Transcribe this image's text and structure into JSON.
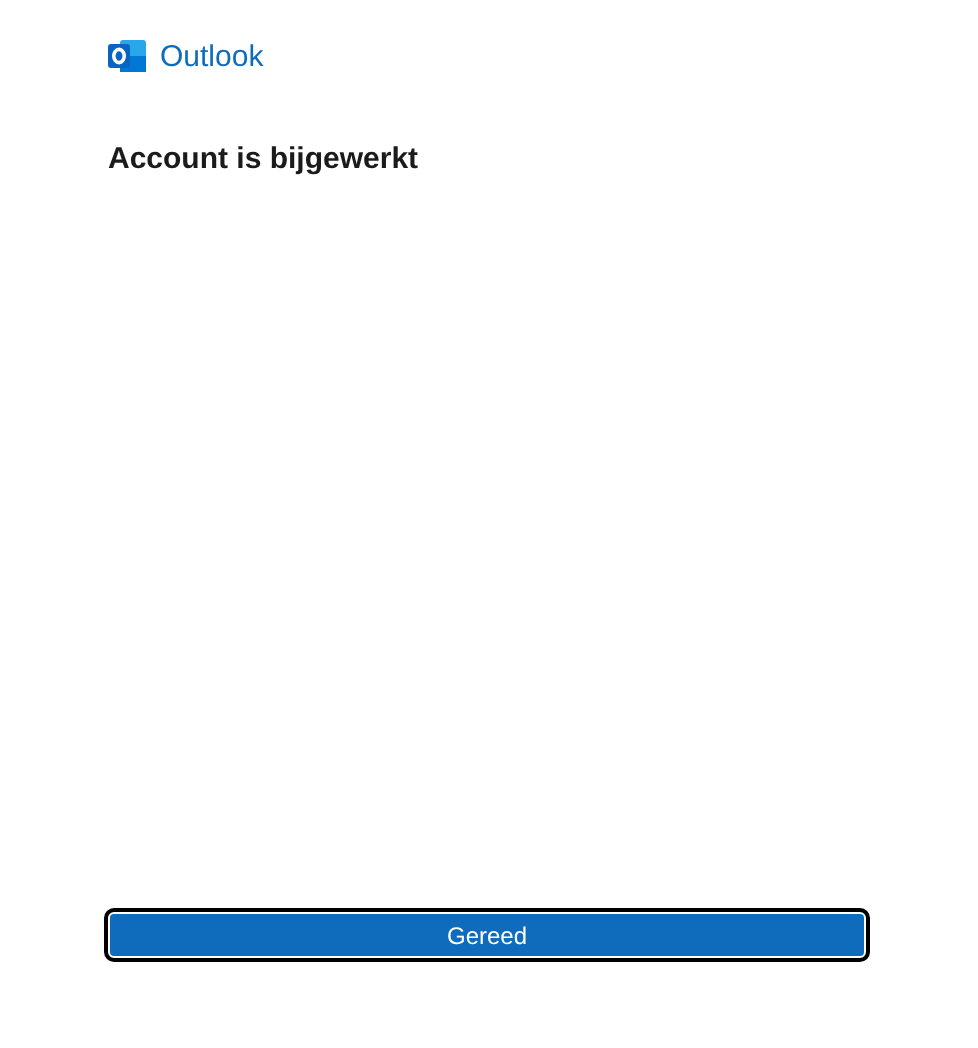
{
  "app": {
    "name": "Outlook"
  },
  "heading": "Account is bijgewerkt",
  "button": {
    "label": "Gereed",
    "focused": true
  }
}
